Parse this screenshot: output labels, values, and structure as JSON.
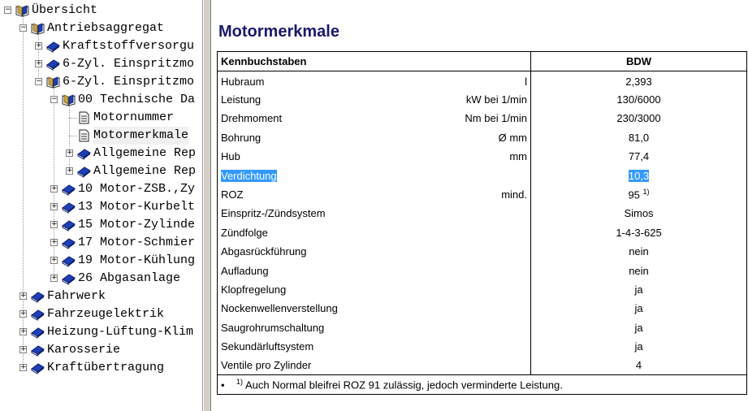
{
  "tree": {
    "nodes": [
      {
        "label": "Übersicht",
        "level": 0,
        "expander": "minus",
        "icon": "open-book"
      },
      {
        "label": "Antriebsaggregat",
        "level": 1,
        "expander": "minus",
        "icon": "open-book"
      },
      {
        "label": "Kraftstoffversorgu",
        "level": 2,
        "expander": "plus",
        "icon": "closed-book"
      },
      {
        "label": "6-Zyl. Einspritzmo",
        "level": 2,
        "expander": "plus",
        "icon": "closed-book"
      },
      {
        "label": "6-Zyl. Einspritzmo",
        "level": 2,
        "expander": "minus",
        "icon": "open-book"
      },
      {
        "label": "00 Technische Da",
        "level": 3,
        "expander": "minus",
        "icon": "open-book"
      },
      {
        "label": "Motornummer",
        "level": 4,
        "expander": "none",
        "icon": "document"
      },
      {
        "label": "Motormerkmale",
        "level": 4,
        "expander": "none",
        "icon": "document",
        "selected": true
      },
      {
        "label": "Allgemeine Rep",
        "level": 4,
        "expander": "plus",
        "icon": "closed-book"
      },
      {
        "label": "Allgemeine Rep",
        "level": 4,
        "expander": "plus",
        "icon": "closed-book"
      },
      {
        "label": "10 Motor-ZSB.,Zy",
        "level": 3,
        "expander": "plus",
        "icon": "closed-book"
      },
      {
        "label": "13 Motor-Kurbelt",
        "level": 3,
        "expander": "plus",
        "icon": "closed-book"
      },
      {
        "label": "15 Motor-Zylinde",
        "level": 3,
        "expander": "plus",
        "icon": "closed-book"
      },
      {
        "label": "17 Motor-Schmier",
        "level": 3,
        "expander": "plus",
        "icon": "closed-book"
      },
      {
        "label": "19 Motor-Kühlung",
        "level": 3,
        "expander": "plus",
        "icon": "closed-book"
      },
      {
        "label": "26 Abgasanlage",
        "level": 3,
        "expander": "plus",
        "icon": "closed-book"
      },
      {
        "label": "Fahrwerk",
        "level": 1,
        "expander": "plus",
        "icon": "closed-book"
      },
      {
        "label": "Fahrzeugelektrik",
        "level": 1,
        "expander": "plus",
        "icon": "closed-book"
      },
      {
        "label": "Heizung-Lüftung-Klim",
        "level": 1,
        "expander": "plus",
        "icon": "closed-book"
      },
      {
        "label": "Karosserie",
        "level": 1,
        "expander": "plus",
        "icon": "closed-book"
      },
      {
        "label": "Kraftübertragung",
        "level": 1,
        "expander": "plus",
        "icon": "closed-book"
      }
    ]
  },
  "content": {
    "title": "Motormerkmale",
    "table": {
      "header_param": "Kennbuchstaben",
      "header_value": "BDW",
      "rows": [
        {
          "name": "Hubraum",
          "unit": "l",
          "value": "2,393"
        },
        {
          "name": "Leistung",
          "unit": "kW bei 1/min",
          "value": "130/6000"
        },
        {
          "name": "Drehmoment",
          "unit": "Nm bei 1/min",
          "value": "230/3000"
        },
        {
          "name": "Bohrung",
          "unit": "Ø mm",
          "value": "81,0"
        },
        {
          "name": "Hub",
          "unit": "mm",
          "value": "77,4"
        },
        {
          "name": "Verdichtung",
          "unit": "",
          "value": "10,3",
          "highlighted": true
        },
        {
          "name": "ROZ",
          "unit": "mind.",
          "value": "95",
          "sup": "1)"
        },
        {
          "name": "Einspritz-/Zündsystem",
          "unit": "",
          "value": "Simos"
        },
        {
          "name": "Zündfolge",
          "unit": "",
          "value": "1-4-3-625"
        },
        {
          "name": "Abgasrückführung",
          "unit": "",
          "value": "nein"
        },
        {
          "name": "Aufladung",
          "unit": "",
          "value": "nein"
        },
        {
          "name": "Klopfregelung",
          "unit": "",
          "value": "ja"
        },
        {
          "name": "Nockenwellenverstellung",
          "unit": "",
          "value": "ja"
        },
        {
          "name": "Saugrohrumschaltung",
          "unit": "",
          "value": "ja"
        },
        {
          "name": "Sekundärluftsystem",
          "unit": "",
          "value": "ja"
        },
        {
          "name": "Ventile pro Zylinder",
          "unit": "",
          "value": "4"
        }
      ],
      "footnote_bullet": "•",
      "footnote_sup": "1)",
      "footnote": "Auch Normal bleifrei ROZ 91 zulässig, jedoch verminderte Leistung."
    }
  },
  "colors": {
    "title": "#1a1a6e",
    "selection": "#3399ff",
    "book_blue": "#1f3fb8",
    "book_open": "#c8a24a"
  }
}
